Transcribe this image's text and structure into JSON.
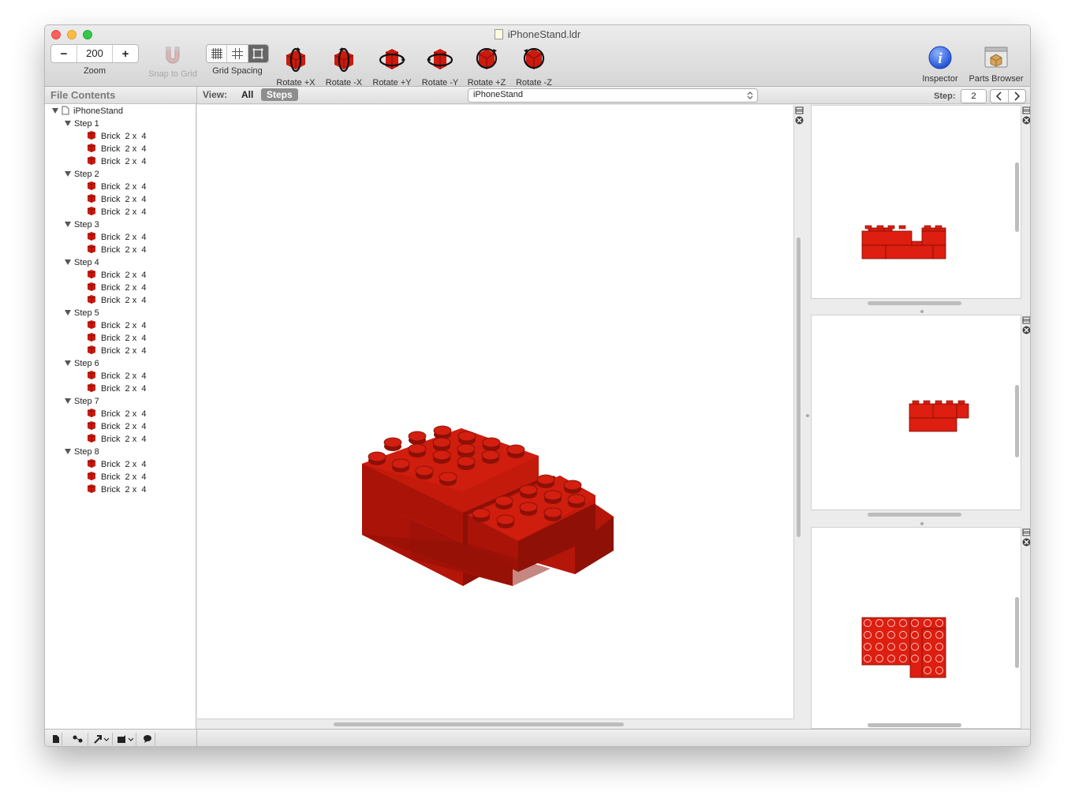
{
  "window": {
    "title": "iPhoneStand.ldr"
  },
  "toolbar": {
    "zoom_minus": "−",
    "zoom_value": "200",
    "zoom_plus": "+",
    "zoom_label": "Zoom",
    "snap_label": "Snap to Grid",
    "grid_label": "Grid Spacing",
    "rotate_px": "Rotate +X",
    "rotate_nx": "Rotate -X",
    "rotate_py": "Rotate +Y",
    "rotate_ny": "Rotate -Y",
    "rotate_pz": "Rotate +Z",
    "rotate_nz": "Rotate -Z",
    "inspector_label": "Inspector",
    "parts_label": "Parts Browser"
  },
  "sidebar": {
    "header": "File Contents",
    "root": "iPhoneStand",
    "steps": [
      {
        "label": "Step 1",
        "parts": [
          "Brick  2 x  4",
          "Brick  2 x  4",
          "Brick  2 x  4"
        ]
      },
      {
        "label": "Step 2",
        "parts": [
          "Brick  2 x  4",
          "Brick  2 x  4",
          "Brick  2 x  4"
        ]
      },
      {
        "label": "Step 3",
        "parts": [
          "Brick  2 x  4",
          "Brick  2 x  4"
        ]
      },
      {
        "label": "Step 4",
        "parts": [
          "Brick  2 x  4",
          "Brick  2 x  4",
          "Brick  2 x  4"
        ]
      },
      {
        "label": "Step 5",
        "parts": [
          "Brick  2 x  4",
          "Brick  2 x  4",
          "Brick  2 x  4"
        ]
      },
      {
        "label": "Step 6",
        "parts": [
          "Brick  2 x  4",
          "Brick  2 x  4"
        ]
      },
      {
        "label": "Step 7",
        "parts": [
          "Brick  2 x  4",
          "Brick  2 x  4",
          "Brick  2 x  4"
        ]
      },
      {
        "label": "Step 8",
        "parts": [
          "Brick  2 x  4",
          "Brick  2 x  4",
          "Brick  2 x  4"
        ]
      }
    ]
  },
  "viewbar": {
    "view_label": "View:",
    "all": "All",
    "steps": "Steps",
    "model_select": "iPhoneStand",
    "step_label": "Step:",
    "step_value": "2",
    "prev": "‹",
    "next": "›"
  },
  "colors": {
    "brick": "#cc1a0e",
    "brick_dark": "#9e1408",
    "accent": "#8e8e8e"
  }
}
